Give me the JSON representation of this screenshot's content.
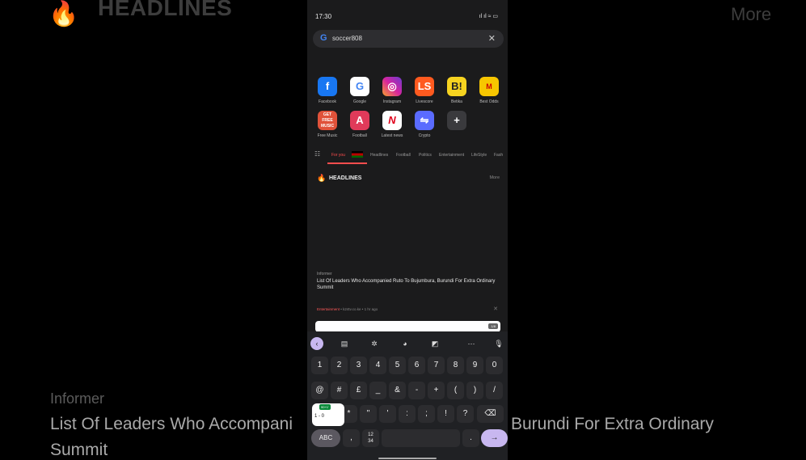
{
  "background": {
    "headlines": "HEADLINES",
    "more": "More",
    "informer": "Informer",
    "title_line1a": "List Of Leaders Who Accompani",
    "title_line1b": "Burundi For Extra Ordinary",
    "title_line2": "Summit"
  },
  "status": {
    "time": "17:30",
    "icons": "ıl ıl ≈ ▭"
  },
  "search": {
    "query": "soccer808",
    "clear": "✕"
  },
  "speed_dial": [
    {
      "label": "Facebook",
      "icon": "facebook-icon",
      "color": "#1877f2",
      "glyph": "f"
    },
    {
      "label": "Google",
      "icon": "google-icon",
      "color": "#ffffff",
      "glyph": "G"
    },
    {
      "label": "Instagram",
      "icon": "instagram-icon",
      "color": "#d6249f",
      "glyph": "◎"
    },
    {
      "label": "Livescore",
      "icon": "livescore-icon",
      "color": "#ff5a1f",
      "glyph": "LS"
    },
    {
      "label": "Betika",
      "icon": "betika-icon",
      "color": "#f6d320",
      "glyph": "B!"
    },
    {
      "label": "Best Odds",
      "icon": "mozzartbet-icon",
      "color": "#f7c600",
      "glyph": "M"
    },
    {
      "label": "Free Music",
      "icon": "free-music-icon",
      "color": "#e0523a",
      "glyph": "GET FREE MUSIC"
    },
    {
      "label": "Football",
      "icon": "football-icon",
      "color": "#e03a5a",
      "glyph": "A"
    },
    {
      "label": "Latest news",
      "icon": "latest-news-icon",
      "color": "#ffffff",
      "glyph": "N"
    },
    {
      "label": "Crypto",
      "icon": "crypto-icon",
      "color": "#5a6bff",
      "glyph": "⇋"
    },
    {
      "label": "",
      "icon": "add-icon",
      "color": "#3a3a3d",
      "glyph": "+"
    }
  ],
  "tabs": [
    "For you",
    "Headlines",
    "Football",
    "Politics",
    "Entertainment",
    "LifeStyle",
    "Fash"
  ],
  "headlines": {
    "title": "HEADLINES",
    "more": "More"
  },
  "article": {
    "source": "Informer",
    "title": "List Of Leaders Who Accompanied Ruto To Bujumbura, Burundi For Extra Ordinary Summit",
    "category": "Entertainment",
    "meta": " • k24tv.co.ke • 1 hr ago",
    "card_badge": "1/8"
  },
  "keyboard": {
    "row1": [
      "1",
      "2",
      "3",
      "4",
      "5",
      "6",
      "7",
      "8",
      "9",
      "0"
    ],
    "row2": [
      "@",
      "#",
      "£",
      "_",
      "&",
      "-",
      "+",
      "(",
      ")",
      "/"
    ],
    "row3": [
      "*",
      "\"",
      "'",
      ":",
      ";",
      "!",
      "?"
    ],
    "abc": "ABC",
    "comma": ",",
    "numpad": "12\n34",
    "period": ".",
    "enter": "→"
  },
  "score_widget": {
    "live": "90+1'",
    "score": "1 - 0"
  }
}
